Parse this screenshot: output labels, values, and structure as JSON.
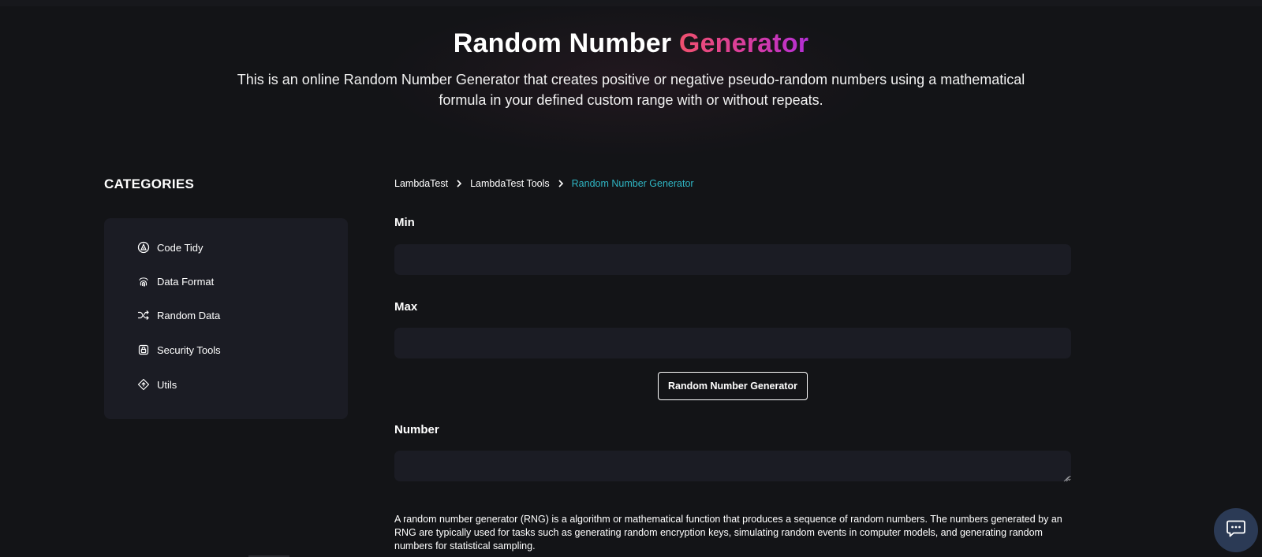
{
  "hero": {
    "title_plain": "Random Number ",
    "title_accent": "Generator",
    "description": "This is an online Random Number Generator that creates positive or negative pseudo-random numbers using a mathematical formula in your defined custom range with or without repeats."
  },
  "sidebar": {
    "title": "CATEGORIES",
    "items": [
      {
        "label": "Code Tidy",
        "icon": "code-tidy-icon"
      },
      {
        "label": "Data Format",
        "icon": "fingerprint-icon"
      },
      {
        "label": "Random Data",
        "icon": "shuffle-icon"
      },
      {
        "label": "Security Tools",
        "icon": "lock-icon"
      },
      {
        "label": "Utils",
        "icon": "utils-diamond-icon"
      }
    ]
  },
  "breadcrumb": {
    "items": [
      "LambdaTest",
      "LambdaTest Tools",
      "Random Number Generator"
    ]
  },
  "form": {
    "min_label": "Min",
    "min_value": "",
    "max_label": "Max",
    "max_value": "",
    "button_label": "Random Number Generator",
    "number_label": "Number",
    "number_value": ""
  },
  "info": {
    "text": "A random number generator (RNG) is a algorithm or mathematical function that produces a sequence of random numbers. The numbers generated by an RNG are typically used for tasks such as generating random encryption keys, simulating random events in computer models, and generating random numbers for statistical sampling."
  },
  "colors": {
    "background": "#131417",
    "panel": "#1b1c24",
    "breadcrumb_current": "#2fb6c4",
    "accent_gradient_start": "#f0506e",
    "accent_gradient_end": "#b42fd6",
    "chat_button": "#2b3a55"
  },
  "chat": {
    "icon": "chat-bubble-icon"
  }
}
